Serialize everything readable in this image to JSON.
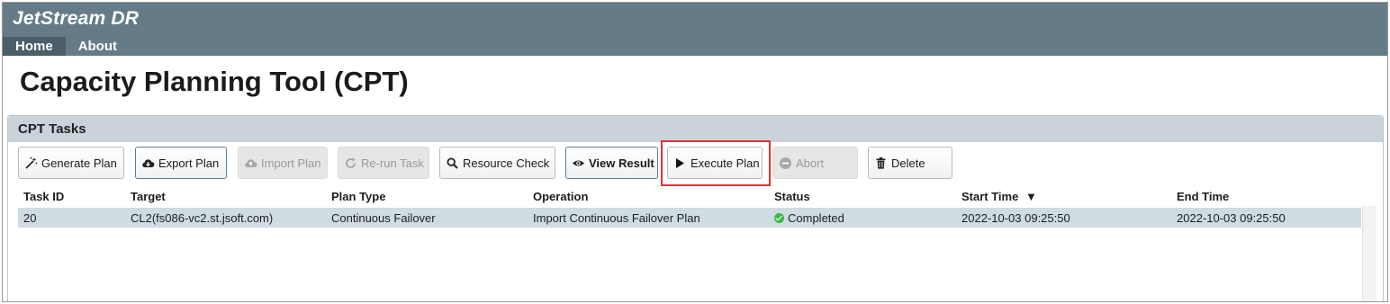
{
  "app": {
    "brand": "JetStream DR"
  },
  "nav": [
    {
      "label": "Home",
      "active": true
    },
    {
      "label": "About",
      "active": false
    }
  ],
  "page": {
    "title": "Capacity Planning Tool (CPT)"
  },
  "panel": {
    "title": "CPT Tasks"
  },
  "toolbar": {
    "generate_plan": "Generate Plan",
    "export_plan": "Export Plan",
    "import_plan": "Import Plan",
    "rerun_task": "Re-run Task",
    "resource_check": "Resource Check",
    "view_result": "View Result",
    "execute_plan": "Execute Plan",
    "abort": "Abort",
    "delete": "Delete"
  },
  "table": {
    "columns": {
      "task_id": "Task ID",
      "target": "Target",
      "plan_type": "Plan Type",
      "operation": "Operation",
      "status": "Status",
      "start_time": "Start Time",
      "end_time": "End Time"
    },
    "sort_indicator": "▼",
    "rows": [
      {
        "task_id": "20",
        "target": "CL2(fs086-vc2.st.jsoft.com)",
        "plan_type": "Continuous Failover",
        "operation": "Import Continuous Failover Plan",
        "status": "Completed",
        "start_time": "2022-10-03 09:25:50",
        "end_time": "2022-10-03 09:25:50"
      }
    ]
  },
  "colors": {
    "header_bg": "#667b88",
    "nav_active_bg": "#4b5e6a",
    "panel_header_bg": "#c9d3d9",
    "selected_row_bg": "#cfdde2",
    "highlight_border": "#e03131",
    "status_ok": "#3cb64a"
  },
  "icons": {
    "generate_plan": "magic-wand-icon",
    "export_plan": "cloud-download-icon",
    "import_plan": "cloud-upload-icon",
    "rerun_task": "refresh-icon",
    "resource_check": "search-icon",
    "view_result": "eye-icon",
    "execute_plan": "play-icon",
    "abort": "minus-circle-icon",
    "delete": "trash-icon",
    "status": "check-circle-icon"
  }
}
